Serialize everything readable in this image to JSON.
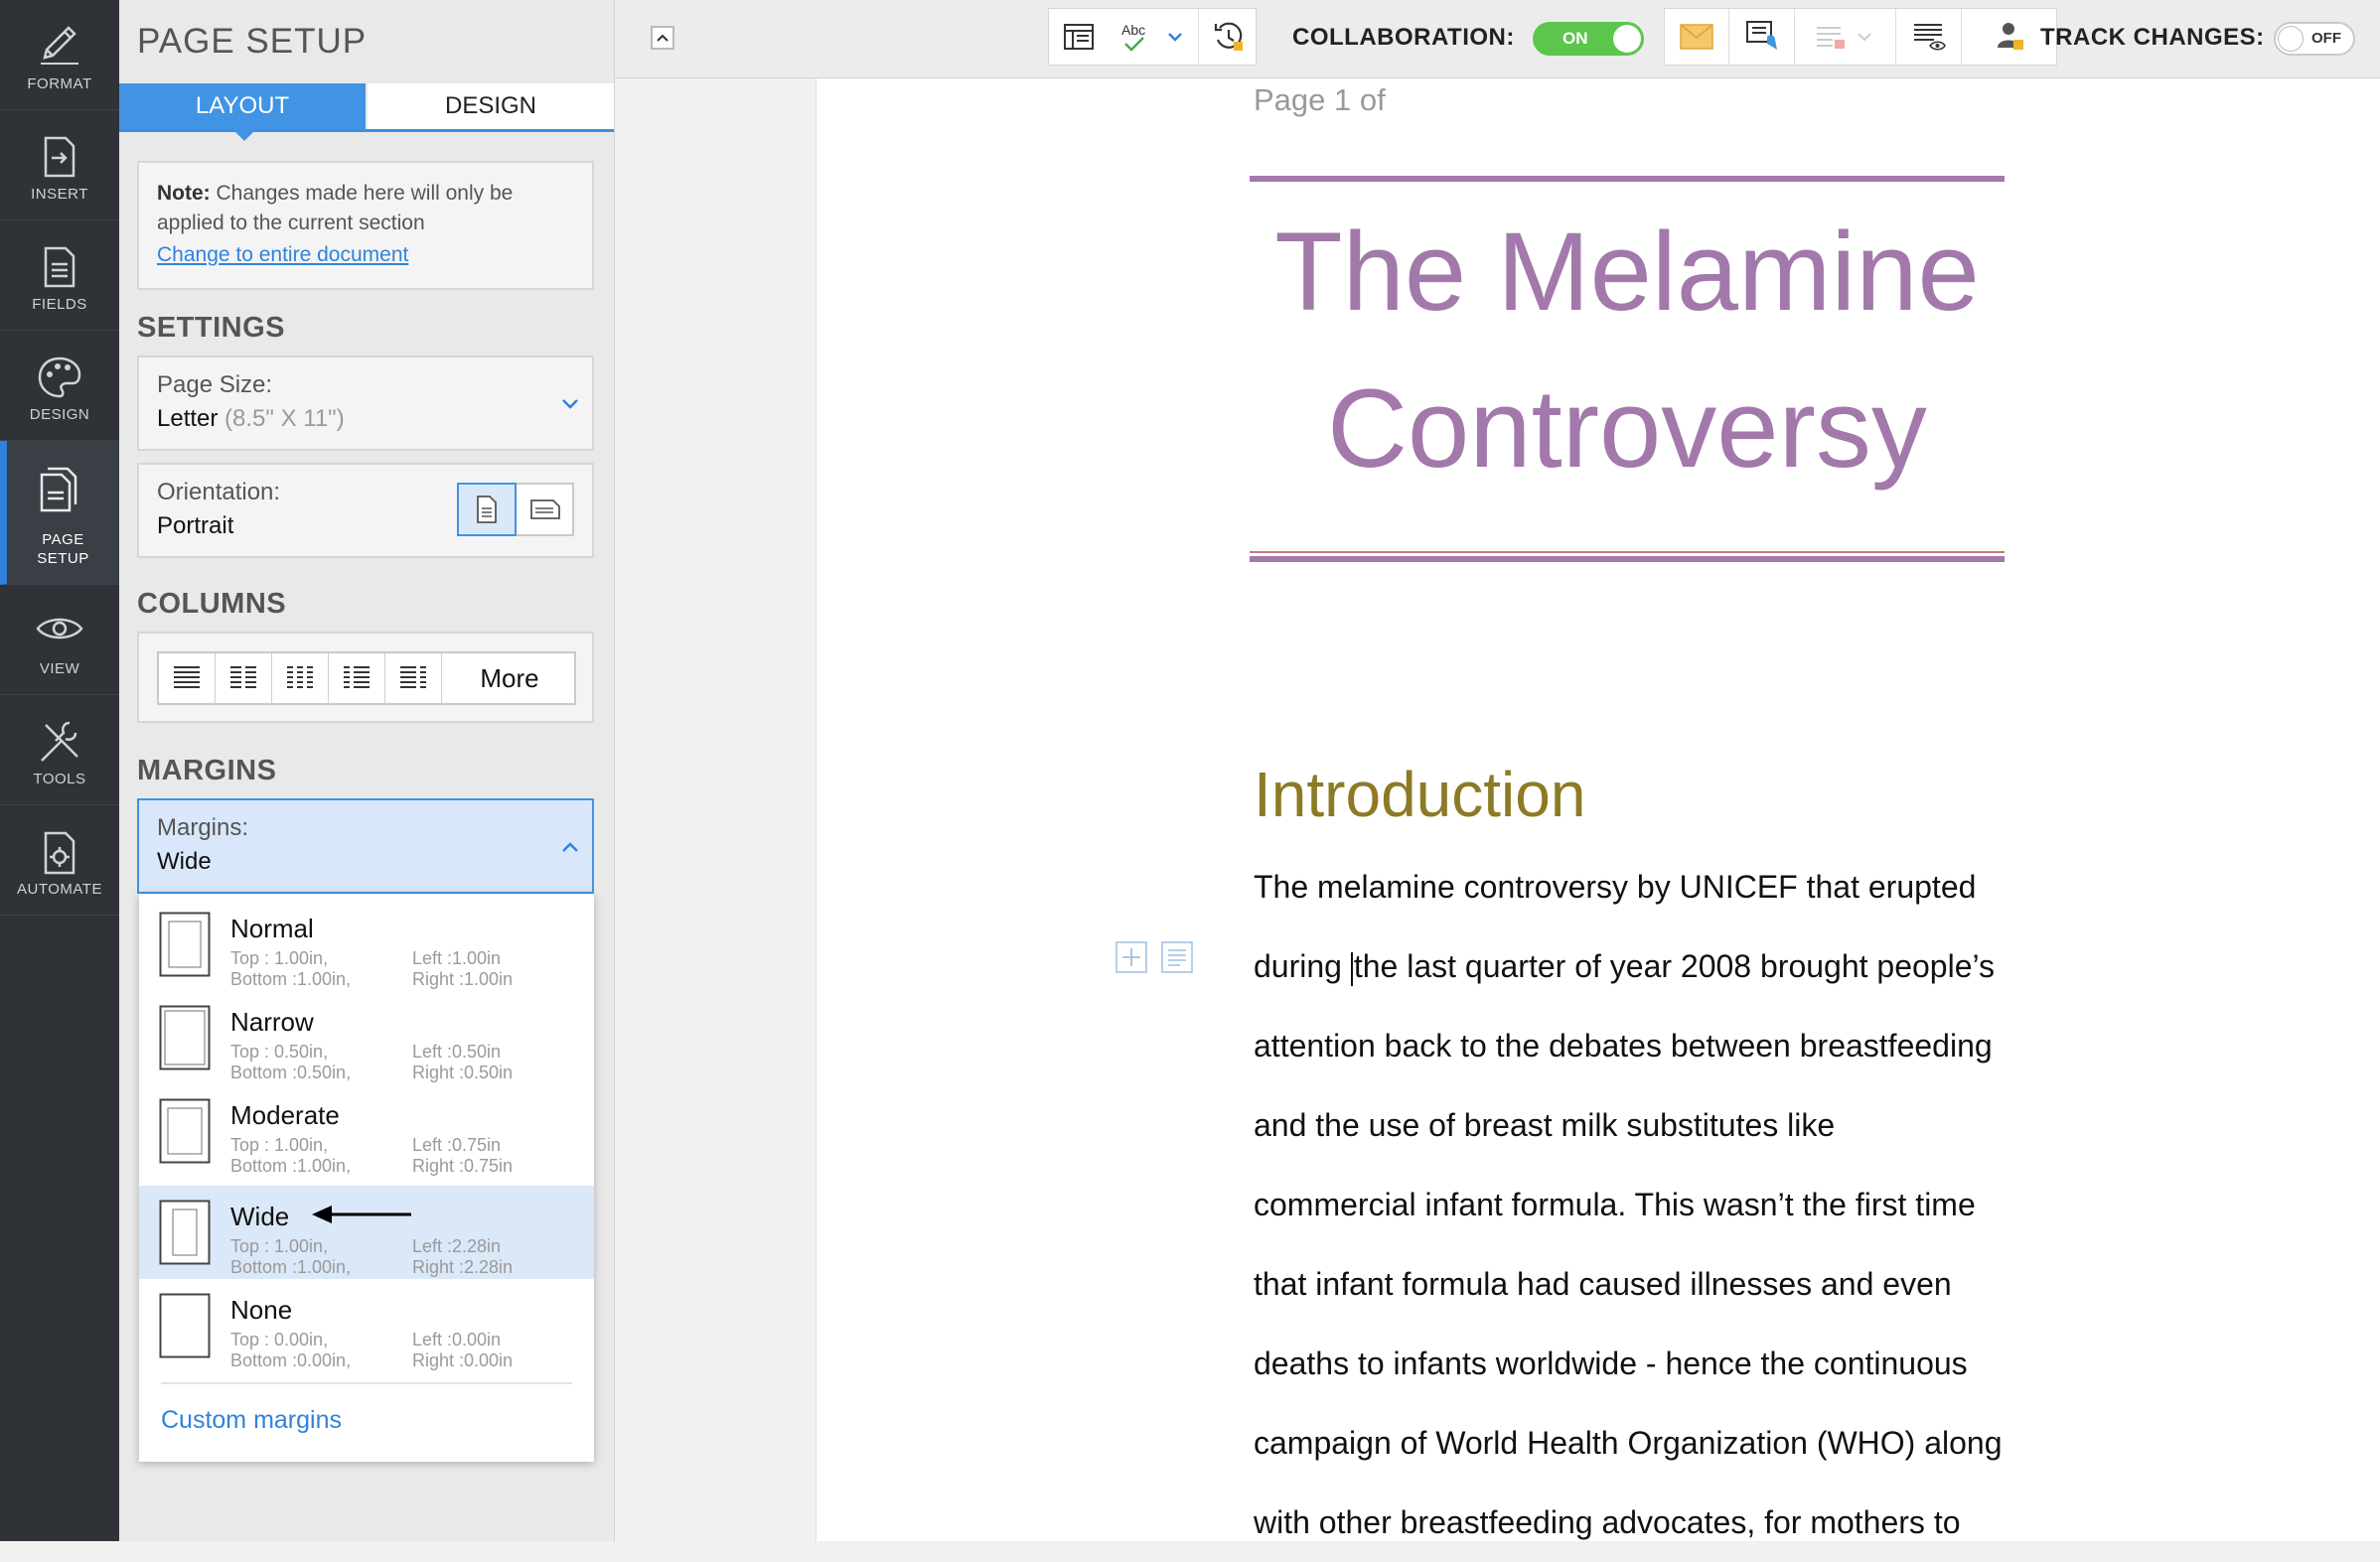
{
  "rail": {
    "items": [
      {
        "label": "FORMAT",
        "icon": "pencil-icon"
      },
      {
        "label": "INSERT",
        "icon": "insert-icon"
      },
      {
        "label": "FIELDS",
        "icon": "fields-icon"
      },
      {
        "label": "DESIGN",
        "icon": "palette-icon"
      },
      {
        "label": "PAGE\nSETUP",
        "icon": "page-setup-icon"
      },
      {
        "label": "VIEW",
        "icon": "eye-icon"
      },
      {
        "label": "TOOLS",
        "icon": "tools-icon"
      },
      {
        "label": "AUTOMATE",
        "icon": "automate-icon"
      }
    ],
    "page_setup_line1": "PAGE",
    "page_setup_line2": "SETUP"
  },
  "panel": {
    "title": "PAGE SETUP",
    "tabs": {
      "layout": "LAYOUT",
      "design": "DESIGN"
    },
    "note": {
      "bold": "Note:",
      "text": " Changes made here will only be applied to the current section",
      "link": "Change to entire document"
    },
    "settings_heading": "SETTINGS",
    "page_size": {
      "label": "Page Size:",
      "value": "Letter",
      "detail": "(8.5\" X 11\")"
    },
    "orientation": {
      "label": "Orientation:",
      "value": "Portrait"
    },
    "columns_heading": "COLUMNS",
    "columns_more": "More",
    "margins_heading": "MARGINS",
    "margins": {
      "label": "Margins:",
      "value": "Wide"
    },
    "margin_options": [
      {
        "name": "Normal",
        "top": "Top       : 1.00in,",
        "bottom": "Bottom :1.00in,",
        "left": "Left    :1.00in",
        "right": "Right  :1.00in"
      },
      {
        "name": "Narrow",
        "top": "Top       : 0.50in,",
        "bottom": "Bottom :0.50in,",
        "left": "Left    :0.50in",
        "right": "Right  :0.50in"
      },
      {
        "name": "Moderate",
        "top": "Top       : 1.00in,",
        "bottom": "Bottom :1.00in,",
        "left": "Left    :0.75in",
        "right": "Right  :0.75in"
      },
      {
        "name": "Wide",
        "top": "Top       : 1.00in,",
        "bottom": "Bottom :1.00in,",
        "left": "Left    :2.28in",
        "right": "Right  :2.28in"
      },
      {
        "name": "None",
        "top": "Top       : 0.00in,",
        "bottom": "Bottom :0.00in,",
        "left": "Left    :0.00in",
        "right": "Right  :0.00in"
      }
    ],
    "custom_margins": "Custom margins"
  },
  "toolbar": {
    "collaboration_label": "COLLABORATION:",
    "collaboration_state": "ON",
    "track_changes_label": "TRACK CHANGES:",
    "track_changes_state": "OFF",
    "spellcheck_glyph": "Abc"
  },
  "document": {
    "page_number": "Page 1 of",
    "title_line1": "The Melamine",
    "title_line2": "Controversy",
    "heading": "Introduction",
    "body_first": "during ",
    "body_lines": [
      "The melamine controversy by UNICEF that erupted",
      "the last quarter of year 2008 brought people’s",
      "attention back to the debates between breastfeeding",
      "and the use of breast milk substitutes like",
      "commercial infant formula. This wasn’t the first time",
      "that infant formula had caused illnesses and even",
      "deaths to infants worldwide - hence the continuous",
      "campaign of World Health Organization (WHO) along",
      "with other breastfeeding advocates, for mothers to"
    ]
  },
  "colors": {
    "accent": "#4193e4",
    "title": "#a279aa",
    "heading": "#8c7a25",
    "toggle_on": "#5cc64c"
  }
}
